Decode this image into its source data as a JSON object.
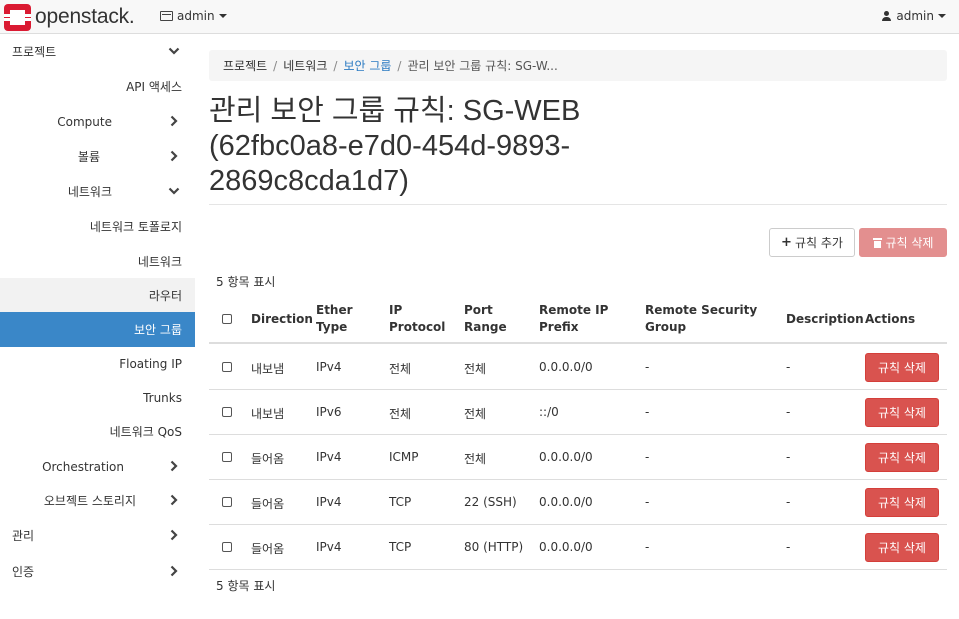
{
  "colors": {
    "active_nav": "#3a87c8",
    "link": "#2a7ac2",
    "danger": "#d9534f",
    "danger_disabled": "#e38f8f",
    "logo_red": "#da1a32"
  },
  "navbar": {
    "brand": "openstack.",
    "project": "admin",
    "user": "admin"
  },
  "sidebar": {
    "items": [
      {
        "label": "프로젝트",
        "icon": "chevron-down-icon"
      },
      {
        "label": "API 액세스"
      },
      {
        "label": "Compute",
        "icon": "chevron-right-icon"
      },
      {
        "label": "볼륨",
        "icon": "chevron-right-icon"
      },
      {
        "label": "네트워크",
        "icon": "chevron-down-icon"
      },
      {
        "label": "네트워크 토폴로지"
      },
      {
        "label": "네트워크"
      },
      {
        "label": "라우터"
      },
      {
        "label": "보안 그룹"
      },
      {
        "label": "Floating IP"
      },
      {
        "label": "Trunks"
      },
      {
        "label": "네트워크 QoS"
      },
      {
        "label": "Orchestration",
        "icon": "chevron-right-icon"
      },
      {
        "label": "오브젝트 스토리지",
        "icon": "chevron-right-icon"
      },
      {
        "label": "관리",
        "icon": "chevron-right-icon"
      },
      {
        "label": "인증",
        "icon": "chevron-right-icon"
      }
    ]
  },
  "breadcrumb": [
    "프로젝트",
    "네트워크",
    "보안 그룹",
    "관리 보안 그룹 규칙: SG-W..."
  ],
  "page": {
    "title_line1": "관리 보안 그룹 규칙: SG-WEB",
    "title_line2": "(62fbc0a8-e7d0-454d-9893-",
    "title_line3": "2869c8cda1d7)"
  },
  "actions": {
    "add_rule": "규칙 추가",
    "delete_rules": "규칙 삭제"
  },
  "table": {
    "count_top": "5 항목 표시",
    "count_bottom": "5 항목 표시",
    "headers": {
      "direction": "Direction",
      "ether1": "Ether",
      "ether2": "Type",
      "ip1": "IP",
      "ip2": "Protocol",
      "port1": "Port",
      "port2": "Range",
      "remote1": "Remote IP",
      "remote2": "Prefix",
      "rsg1": "Remote Security",
      "rsg2": "Group",
      "description": "Description",
      "actions": "Actions"
    },
    "rows": [
      {
        "direction": "내보냄",
        "ether": "IPv4",
        "protocol": "전체",
        "port": "전체",
        "prefix": "0.0.0.0/0",
        "group": "-",
        "description": "-",
        "action": "규칙 삭제"
      },
      {
        "direction": "내보냄",
        "ether": "IPv6",
        "protocol": "전체",
        "port": "전체",
        "prefix": "::/0",
        "group": "-",
        "description": "-",
        "action": "규칙 삭제"
      },
      {
        "direction": "들어옴",
        "ether": "IPv4",
        "protocol": "ICMP",
        "port": "전체",
        "prefix": "0.0.0.0/0",
        "group": "-",
        "description": "-",
        "action": "규칙 삭제"
      },
      {
        "direction": "들어옴",
        "ether": "IPv4",
        "protocol": "TCP",
        "port": "22 (SSH)",
        "prefix": "0.0.0.0/0",
        "group": "-",
        "description": "-",
        "action": "규칙 삭제"
      },
      {
        "direction": "들어옴",
        "ether": "IPv4",
        "protocol": "TCP",
        "port": "80 (HTTP)",
        "prefix": "0.0.0.0/0",
        "group": "-",
        "description": "-",
        "action": "규칙 삭제"
      }
    ]
  }
}
